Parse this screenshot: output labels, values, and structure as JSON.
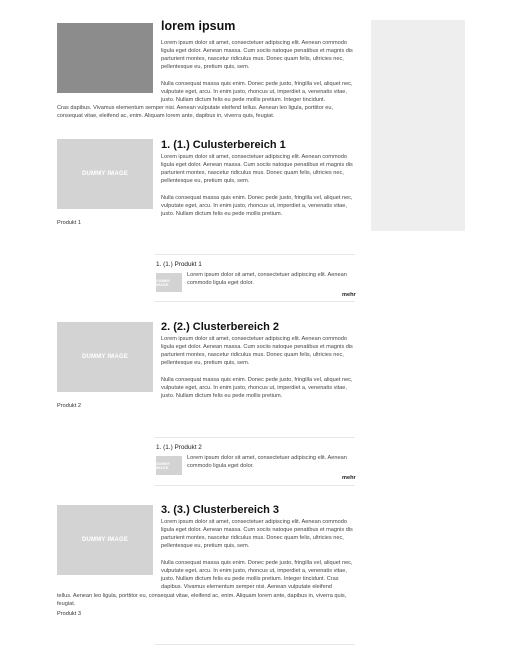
{
  "intro": {
    "title": "lorem ipsum",
    "para1": "Lorem ipsum dolor sit amet, consectetuer adipiscing elit. Aenean commodo ligula eget dolor. Aenean massa. Cum sociis natoque penatibus et magnis dis parturient montes, nascetur ridiculus mus. Donec quam felis, ultricies nec, pellentesque eu, pretium quis, sem.",
    "para2": "Nulla consequat massa quis enim. Donec pede justo, fringilla vel, aliquet nec, vulputate eget, arcu. In enim justo, rhoncus ut, imperdiet a, venenatis vitae, justo. Nullam dictum felis eu pede mollis pretium. Integer tincidunt.",
    "para3": "Cras dapibus. Vivamus elementum semper nisi. Aenean vulputate eleifend tellus. Aenean leo ligula, porttitor eu, consequat vitae, eleifend ac, enim. Aliquam lorem ante, dapibus in, viverra quis, feugiat."
  },
  "dummy_text": "DUMMY IMAGE",
  "more_label": "mehr",
  "clusters": [
    {
      "title": "1. (1.) Culusterbereich 1",
      "para1": "Lorem ipsum dolor sit amet, consectetuer adipiscing elit. Aenean commodo ligula eget dolor. Aenean massa. Cum sociis natoque penatibus et magnis dis parturient montes, nascetur ridiculus mus. Donec quam felis, ultricies nec, pellentesque eu, pretium quis, sem.",
      "para2": "Nulla consequat massa quis enim. Donec pede justo, fringilla vel, aliquet nec, vulputate eget, arcu. In enim justo, rhoncus ut, imperdiet a, venenatis vitae, justo. Nullam dictum felis eu pede mollis pretium.",
      "product_label": "Produkt 1",
      "product_title": "1. (1.) Produkt 1",
      "product_desc": "Lorem ipsum dolor sit amet, consectetuer adipiscing elit. Aenean commodo ligula eget dolor."
    },
    {
      "title": "2. (2.) Clusterbereich 2",
      "para1": "Lorem ipsum dolor sit amet, consectetuer adipiscing elit. Aenean commodo ligula eget dolor. Aenean massa. Cum sociis natoque penatibus et magnis dis parturient montes, nascetur ridiculus mus. Donec quam felis, ultricies nec, pellentesque eu, pretium quis, sem.",
      "para2": "Nulla consequat massa quis enim. Donec pede justo, fringilla vel, aliquet nec, vulputate eget, arcu. In enim justo, rhoncus ut, imperdiet a, venenatis vitae, justo. Nullam dictum felis eu pede mollis pretium.",
      "product_label": "Produkt 2",
      "product_title": "1. (1.) Produkt 2",
      "product_desc": "Lorem ipsum dolor sit amet, consectetuer adipiscing elit. Aenean commodo ligula eget dolor."
    },
    {
      "title": "3. (3.) Clusterbereich 3",
      "para1": "Lorem ipsum dolor sit amet, consectetuer adipiscing elit. Aenean commodo ligula eget dolor. Aenean massa. Cum sociis natoque penatibus et magnis dis parturient montes, nascetur ridiculus mus. Donec quam felis, ultricies nec, pellentesque eu, pretium quis, sem.",
      "para2": "Nulla consequat massa quis enim. Donec pede justo, fringilla vel, aliquet nec, vulputate eget, arcu. In enim justo, rhoncus ut, imperdiet a, venenatis vitae, justo. Nullam dictum felis eu pede mollis pretium. Integer tincidunt. Cras dapibus. Vivamus elementum semper nisi. Aenean vulputate eleifend",
      "para3": "tellus. Aenean leo ligula, porttitor eu, consequat vitae, eleifend ac, enim. Aliquam lorem ante, dapibus in, viverra quis, feugiat.",
      "product_label": "Produkt 3"
    }
  ]
}
